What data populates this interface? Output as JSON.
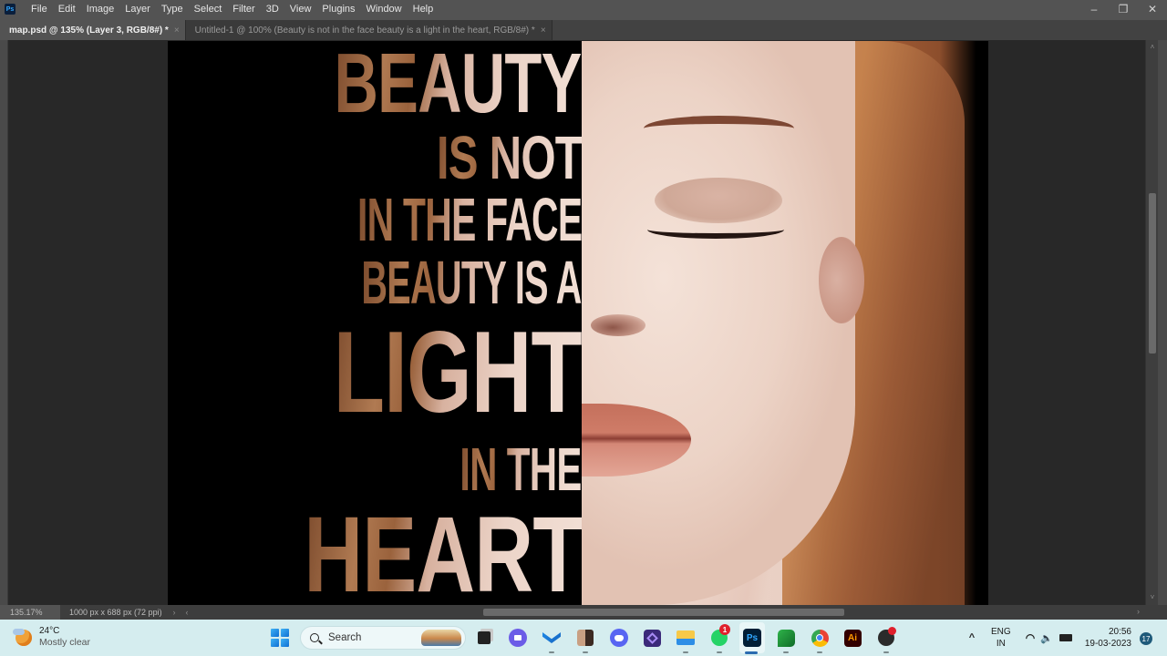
{
  "app": {
    "name": "Adobe Photoshop",
    "logo_text": "Ps",
    "menu": [
      "File",
      "Edit",
      "Image",
      "Layer",
      "Type",
      "Select",
      "Filter",
      "3D",
      "View",
      "Plugins",
      "Window",
      "Help"
    ],
    "window_controls": {
      "minimize": "–",
      "restore": "❐",
      "close": "✕"
    }
  },
  "tabs": [
    {
      "label": "map.psd @ 135% (Layer 3, RGB/8#) *",
      "active": true,
      "close": "×"
    },
    {
      "label": "Untitled-1 @ 100% (Beauty is not in the face beauty is a light in the heart, RGB/8#) *",
      "active": false,
      "close": "×"
    }
  ],
  "canvas": {
    "artwork_lines": [
      "BEAUTY",
      "IS NOT",
      "IN THE FACE",
      "BEAUTY IS A",
      "LIGHT",
      "IN THE",
      "HEART"
    ],
    "subject": "woman portrait with closed eyes, auburn hair"
  },
  "status": {
    "zoom": "135.17%",
    "doc_dimensions": "1000 px x 688 px (72 ppi)",
    "arrow_right": "›",
    "arrow_left": "‹"
  },
  "scrollbars": {
    "vertical_up": "˄",
    "vertical_down": "˅",
    "horizontal_end": "›"
  },
  "taskbar": {
    "weather": {
      "temp": "24°C",
      "desc": "Mostly clear"
    },
    "search_placeholder": "Search",
    "apps": [
      {
        "name": "Task View"
      },
      {
        "name": "Meet"
      },
      {
        "name": "Widgets app"
      },
      {
        "name": "Photos"
      },
      {
        "name": "Discord"
      },
      {
        "name": "Visual Studio"
      },
      {
        "name": "File Explorer"
      },
      {
        "name": "WhatsApp",
        "badge": "1"
      },
      {
        "name": "Photoshop",
        "label": "Ps",
        "active": true
      },
      {
        "name": "Evernote"
      },
      {
        "name": "Chrome"
      },
      {
        "name": "Illustrator",
        "label": "Ai"
      },
      {
        "name": "OBS Studio",
        "badge": ""
      }
    ],
    "tray": {
      "chevron": "^",
      "lang_line1": "ENG",
      "lang_line2": "IN",
      "time": "20:56",
      "date": "19-03-2023",
      "notifications": "17"
    }
  }
}
